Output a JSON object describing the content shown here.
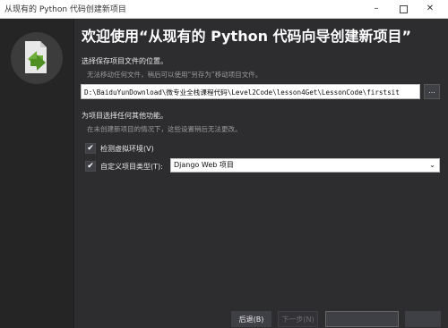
{
  "window": {
    "title": "从现有的 Python 代码创建新项目",
    "minimize_glyph": "–",
    "close_glyph": "✕"
  },
  "wizard": {
    "heading": "欢迎使用“从现有的 Python 代码向导创建新项目”",
    "location_label": "选择保存项目文件的位置。",
    "location_hint": "无法移动任何文件，稍后可以使用“另存为”移动项目文件。",
    "path_value": "D:\\BaiduYunDownload\\微专业全栈课程代码\\Level2Code\\lesson4Get\\LessonCode\\firstsit",
    "browse_label": "...",
    "features_label": "为项目选择任何其他功能。",
    "features_hint": "在未创建新项目的情况下，这些设置稍后无法更改。",
    "detect_venv": {
      "checked": true,
      "label": "检测虚拟环境(V)",
      "check_glyph": "✔"
    },
    "custom_type": {
      "checked": true,
      "label": "自定义项目类型(T):",
      "check_glyph": "✔"
    },
    "project_type_selected": "Django Web 项目",
    "dropdown_glyph": "⌄"
  },
  "footer": {
    "back_label": "后退(B)",
    "next_label": "下一步(N)",
    "create_label": "",
    "cancel_label": ""
  }
}
